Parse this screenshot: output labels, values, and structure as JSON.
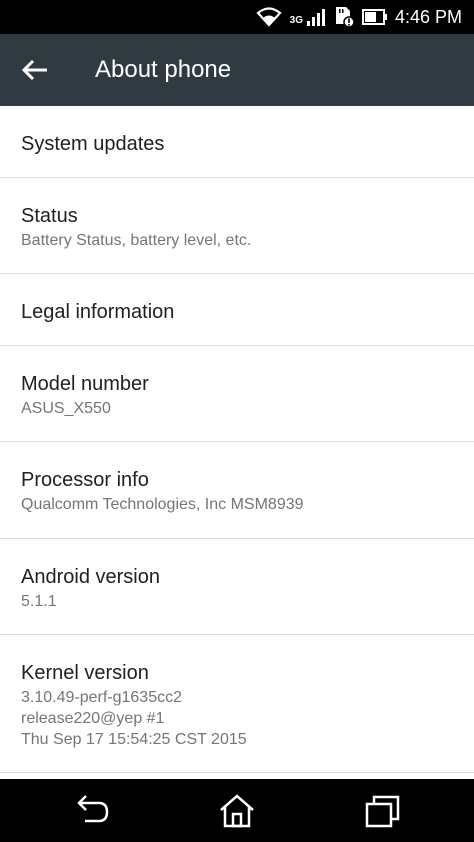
{
  "status_bar": {
    "time": "4:46 PM",
    "network_type": "3G",
    "icons": [
      "wifi-icon",
      "signal-icon",
      "sd-card-icon",
      "battery-icon"
    ]
  },
  "app_bar": {
    "title": "About phone",
    "back_icon": "arrow-back-icon"
  },
  "items": [
    {
      "title": "System updates",
      "summary": ""
    },
    {
      "title": "Status",
      "summary": "Battery Status, battery level, etc."
    },
    {
      "title": "Legal information",
      "summary": ""
    },
    {
      "title": "Model number",
      "summary": "ASUS_X550"
    },
    {
      "title": "Processor info",
      "summary": "Qualcomm Technologies, Inc MSM8939"
    },
    {
      "title": "Android version",
      "summary": "5.1.1"
    },
    {
      "title": "Kernel version",
      "summary_lines": [
        "3.10.49-perf-g1635cc2",
        "release220@yep #1",
        "Thu Sep 17 15:54:25 CST 2015"
      ]
    }
  ],
  "nav_bar": {
    "icons": [
      "back-nav-icon",
      "home-icon",
      "recents-icon"
    ]
  },
  "colors": {
    "app_bar": "#2f3a41",
    "title_text": "#212121",
    "summary_text": "#757575",
    "divider": "#dcdcdc"
  }
}
